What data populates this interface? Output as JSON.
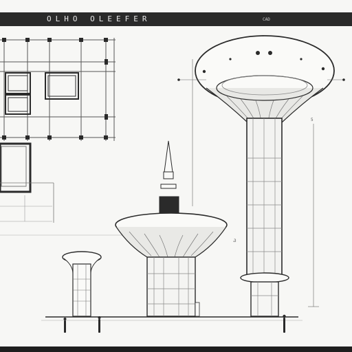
{
  "header": {
    "title": "OLHO OLEEFER",
    "tag": "CAD"
  },
  "palette": {
    "ink": "#2a2a2a",
    "paper": "#f7f7f5",
    "shade": "#d9d9d6"
  },
  "drawing": {
    "scale_marks": [
      "3",
      "5"
    ]
  }
}
